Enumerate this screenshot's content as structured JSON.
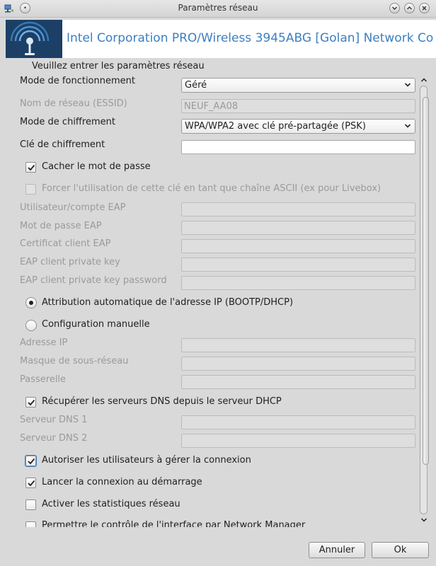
{
  "window": {
    "title": "Paramètres réseau"
  },
  "banner": {
    "text": "Intel Corporation PRO/Wireless 3945ABG [Golan] Network Co"
  },
  "heading": "Veuillez entrer les paramètres réseau",
  "fields": {
    "mode_fonctionnement": {
      "label": "Mode de fonctionnement",
      "value": "Géré"
    },
    "essid": {
      "label": "Nom de réseau (ESSID)",
      "value": "NEUF_AA08"
    },
    "mode_chiffrement": {
      "label": "Mode de chiffrement",
      "value": "WPA/WPA2 avec clé pré-partagée (PSK)"
    },
    "cle_chiffrement": {
      "label": "Clé de chiffrement",
      "value": ""
    },
    "eap_user": {
      "label": "Utilisateur/compte EAP",
      "value": ""
    },
    "eap_password": {
      "label": "Mot de passe EAP",
      "value": ""
    },
    "eap_client_cert": {
      "label": "Certificat client EAP",
      "value": ""
    },
    "eap_private_key": {
      "label": "EAP client private key",
      "value": ""
    },
    "eap_private_key_password": {
      "label": "EAP client private key password",
      "value": ""
    },
    "ip_address": {
      "label": "Adresse IP",
      "value": ""
    },
    "netmask": {
      "label": "Masque de sous-réseau",
      "value": ""
    },
    "gateway": {
      "label": "Passerelle",
      "value": ""
    },
    "dns1": {
      "label": "Serveur DNS 1",
      "value": ""
    },
    "dns2": {
      "label": "Serveur DNS 2",
      "value": ""
    }
  },
  "options": {
    "hide_password": {
      "label": "Cacher le mot de passe",
      "checked": true
    },
    "force_ascii": {
      "label": "Forcer l'utilisation de cette clé en tant que chaîne ASCII (ex pour Livebox)",
      "checked": false
    },
    "ip_auto": {
      "label": "Attribution automatique de l'adresse IP (BOOTP/DHCP)",
      "selected": true
    },
    "ip_manual": {
      "label": "Configuration manuelle",
      "selected": false
    },
    "dns_from_dhcp": {
      "label": "Récupérer les serveurs DNS depuis le serveur DHCP",
      "checked": true
    },
    "allow_users": {
      "label": "Autoriser les utilisateurs à gérer la connexion",
      "checked": true
    },
    "start_on_boot": {
      "label": "Lancer la connexion au démarrage",
      "checked": true
    },
    "enable_stats": {
      "label": "Activer les statistiques réseau",
      "checked": false
    },
    "network_manager": {
      "label": "Permettre le contrôle de l'interface par Network Manager",
      "checked": false
    }
  },
  "buttons": {
    "cancel": "Annuler",
    "ok": "Ok"
  },
  "icons": {
    "app": "network-icon",
    "banner": "wireless-antenna-icon",
    "minimize": "minimize-icon",
    "maximize": "maximize-icon",
    "close": "close-icon",
    "menu": "window-menu-icon"
  },
  "colors": {
    "banner_text": "#3c7fc0",
    "banner_bg": "#1c3f66",
    "disabled_text": "#9a9a9a",
    "focus": "#3c7fc0"
  }
}
